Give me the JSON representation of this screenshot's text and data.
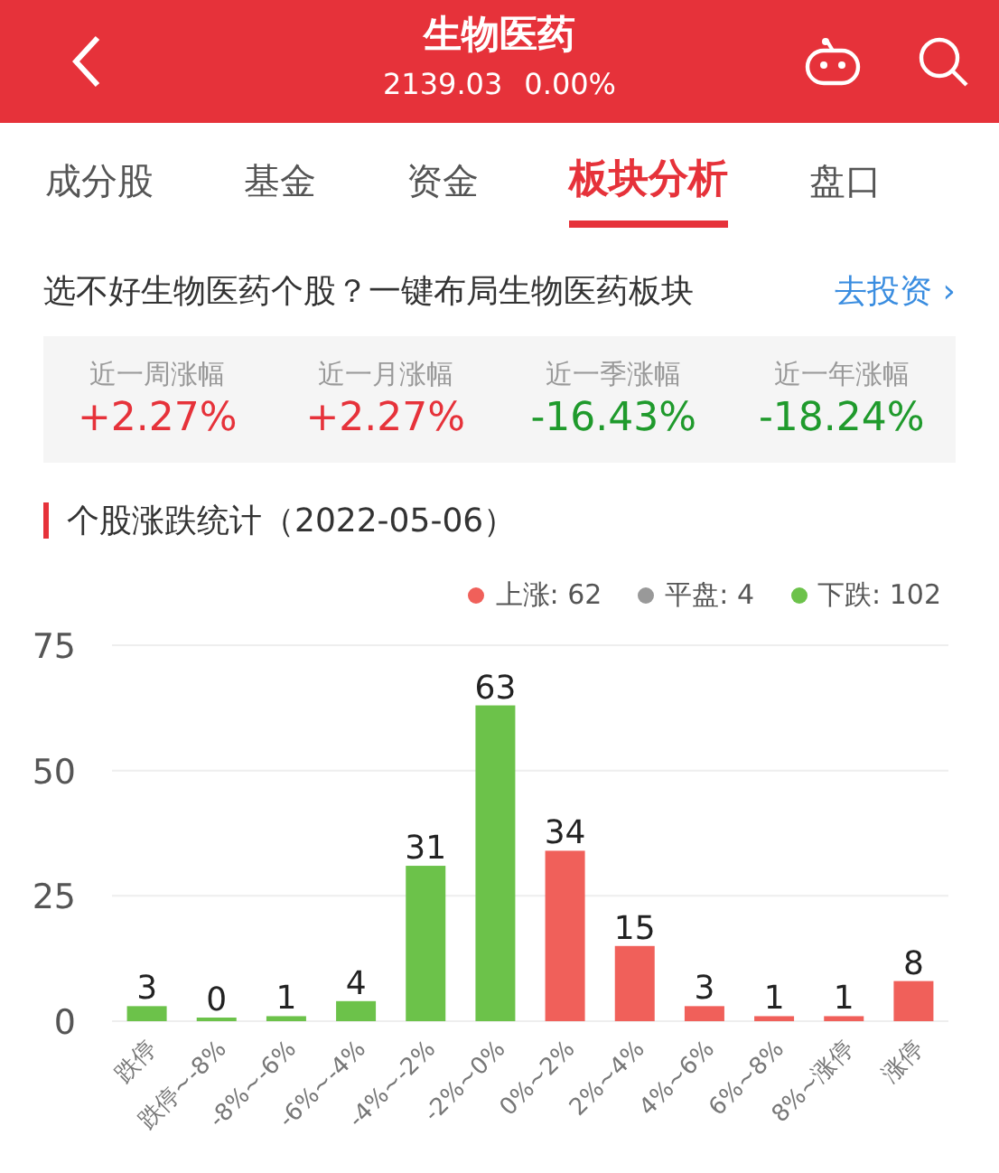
{
  "header": {
    "title": "生物医药",
    "price": "2139.03",
    "change": "0.00%"
  },
  "tabs": [
    {
      "label": "成分股",
      "selected": false
    },
    {
      "label": "基金",
      "selected": false
    },
    {
      "label": "资金",
      "selected": false
    },
    {
      "label": "板块分析",
      "selected": true
    },
    {
      "label": "盘口",
      "selected": false
    }
  ],
  "promo": {
    "text": "选不好生物医药个股？一键布局生物医药板块",
    "link": "去投资 ›"
  },
  "stats": [
    {
      "label": "近一周涨幅",
      "value": "+2.27%",
      "kind": "up"
    },
    {
      "label": "近一月涨幅",
      "value": "+2.27%",
      "kind": "up"
    },
    {
      "label": "近一季涨幅",
      "value": "-16.43%",
      "kind": "down"
    },
    {
      "label": "近一年涨幅",
      "value": "-18.24%",
      "kind": "down"
    }
  ],
  "section": {
    "title": "个股涨跌统计（2022-05-06）",
    "legend": [
      {
        "label": "上涨: 62",
        "color": "#f0605a"
      },
      {
        "label": "平盘: 4",
        "color": "#999999"
      },
      {
        "label": "下跌: 102",
        "color": "#6cc24a"
      }
    ],
    "chart_data": {
      "type": "bar",
      "categories": [
        "跌停",
        "跌停~-8%",
        "-8%~-6%",
        "-6%~-4%",
        "-4%~-2%",
        "-2%~0%",
        "0%~2%",
        "2%~4%",
        "4%~6%",
        "6%~8%",
        "8%~涨停",
        "涨停"
      ],
      "series": [
        {
          "color": "#6cc24a",
          "values": [
            3,
            0,
            1,
            4,
            31,
            63,
            null,
            null,
            null,
            null,
            null,
            null
          ]
        },
        {
          "color": "#f0605a",
          "values": [
            null,
            null,
            null,
            null,
            null,
            null,
            34,
            15,
            3,
            1,
            1,
            8
          ]
        }
      ],
      "ylim": [
        0,
        75
      ],
      "yticks": [
        0,
        25,
        50,
        75
      ],
      "data_labels": true
    }
  }
}
